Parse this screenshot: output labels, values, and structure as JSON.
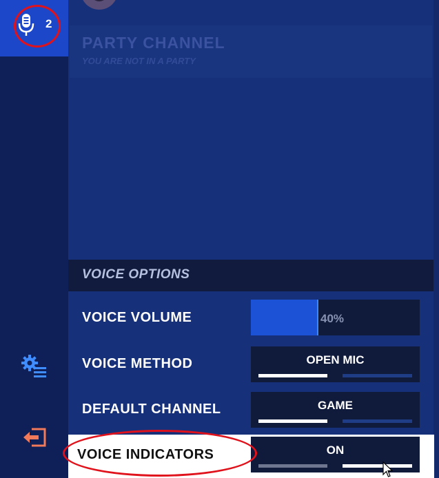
{
  "sidebar": {
    "voice_tab": {
      "icon": "microphone-icon",
      "count": "2",
      "active_color": "#1c47c9"
    },
    "settings_icon": "settings-list-icon",
    "exit_icon": "exit-icon"
  },
  "party": {
    "title": "PARTY CHANNEL",
    "subtitle": "YOU ARE NOT IN A PARTY"
  },
  "voice_options": {
    "header": "VOICE OPTIONS",
    "rows": [
      {
        "label": "VOICE VOLUME",
        "value": "40%",
        "level": 0.4
      },
      {
        "label": "VOICE METHOD",
        "value": "OPEN MIC",
        "selected_index": 0,
        "option_count": 2
      },
      {
        "label": "DEFAULT CHANNEL",
        "value": "GAME",
        "selected_index": 0,
        "option_count": 2
      },
      {
        "label": "VOICE INDICATORS",
        "value": "ON",
        "selected_index": 1,
        "option_count": 2
      }
    ]
  },
  "colors": {
    "accent": "#1b52d6",
    "annotation_ring": "#e0121b",
    "panel": "#17307a"
  }
}
